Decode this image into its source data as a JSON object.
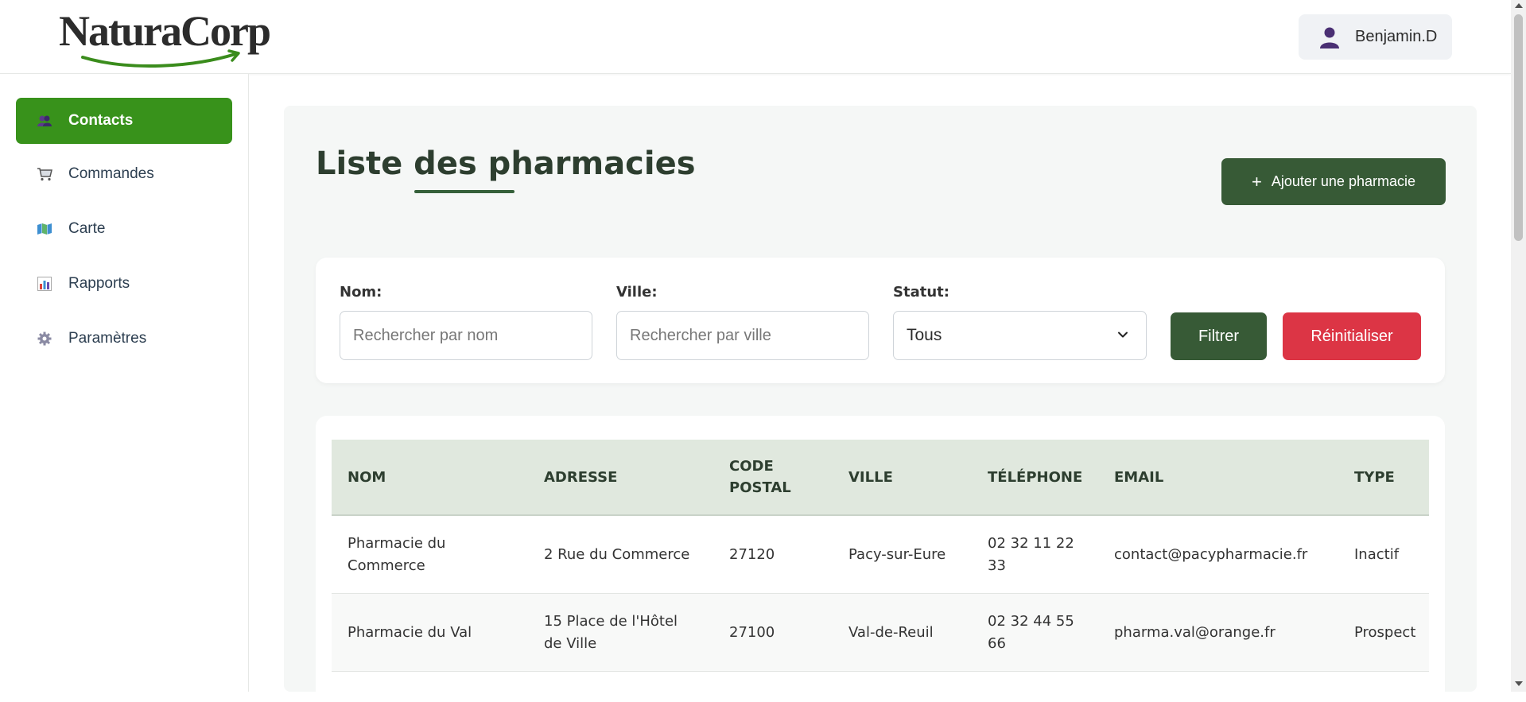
{
  "brand": {
    "logo_text": "NaturaCorp",
    "logo_accent_color": "#3a8c1c"
  },
  "user": {
    "name": "Benjamin.D",
    "icon": "user-icon"
  },
  "sidebar": {
    "items": [
      {
        "label": "Contacts",
        "icon": "users-icon",
        "active": true
      },
      {
        "label": "Commandes",
        "icon": "cart-icon",
        "active": false
      },
      {
        "label": "Carte",
        "icon": "map-icon",
        "active": false
      },
      {
        "label": "Rapports",
        "icon": "bar-chart-icon",
        "active": false
      },
      {
        "label": "Paramètres",
        "icon": "gear-icon",
        "active": false
      }
    ],
    "active_color": "#38921b"
  },
  "main": {
    "title": "Liste des pharmacies",
    "add_button": {
      "icon": "plus-icon",
      "label": "Ajouter une pharmacie"
    }
  },
  "filters": {
    "name": {
      "label": "Nom:",
      "placeholder": "Rechercher par nom",
      "value": ""
    },
    "city": {
      "label": "Ville:",
      "placeholder": "Rechercher par ville",
      "value": ""
    },
    "status": {
      "label": "Statut:",
      "selected": "Tous"
    },
    "filter_button": "Filtrer",
    "reset_button": "Réinitialiser",
    "primary_color": "#375a36",
    "danger_color": "#dc3545"
  },
  "table": {
    "headers": [
      "NOM",
      "ADRESSE",
      "CODE POSTAL",
      "VILLE",
      "TÉLÉPHONE",
      "EMAIL",
      "TYPE"
    ],
    "rows": [
      [
        "Pharmacie du Commerce",
        "2 Rue du Commerce",
        "27120",
        "Pacy-sur-Eure",
        "02 32 11 22 33",
        "contact@pacypharmacie.fr",
        "Inactif"
      ],
      [
        "Pharmacie du Val",
        "15 Place de l'Hôtel de Ville",
        "27100",
        "Val-de-Reuil",
        "02 32 44 55 66",
        "pharma.val@orange.fr",
        "Prospect"
      ]
    ]
  }
}
